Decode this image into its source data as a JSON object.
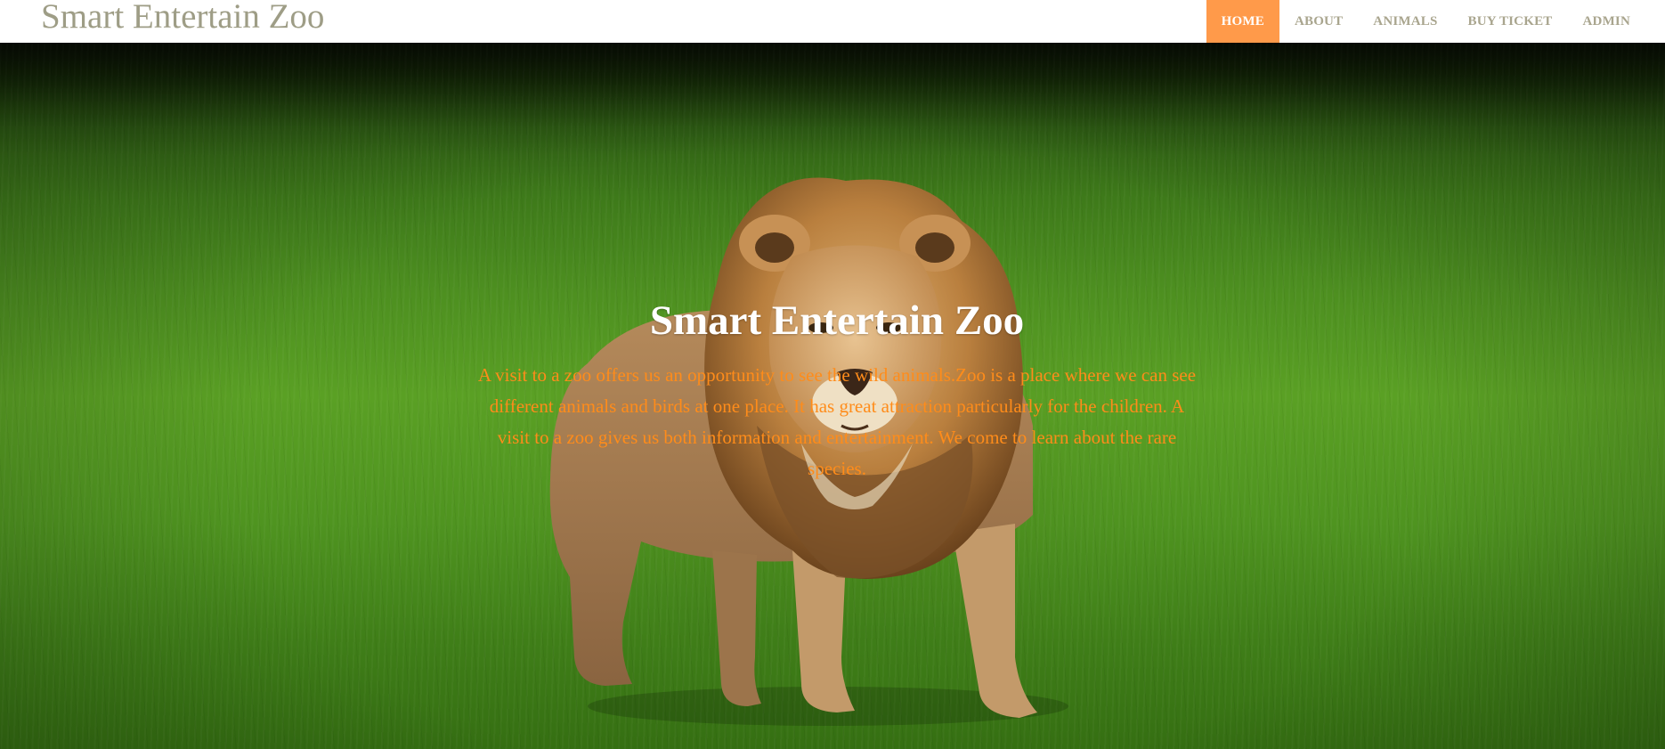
{
  "navbar": {
    "brand": "Smart Entertain Zoo",
    "items": [
      {
        "label": "HOME",
        "active": true
      },
      {
        "label": "ABOUT",
        "active": false
      },
      {
        "label": "ANIMALS",
        "active": false
      },
      {
        "label": "BUY TICKET",
        "active": false
      },
      {
        "label": "ADMIN",
        "active": false
      }
    ],
    "active_color": "#ff9a4a",
    "text_color": "#a9a58e"
  },
  "hero": {
    "title": "Smart Entertain Zoo",
    "description": "A visit to a zoo offers us an opportunity to see the wild animals.Zoo is a place where we can see different animals and birds at one place. It has great attraction particularly for the children. A visit to a zoo gives us both information and entertainment. We come to learn about the rare species.",
    "description_color": "#ff8c1a",
    "background_image": "lion-on-grass"
  }
}
